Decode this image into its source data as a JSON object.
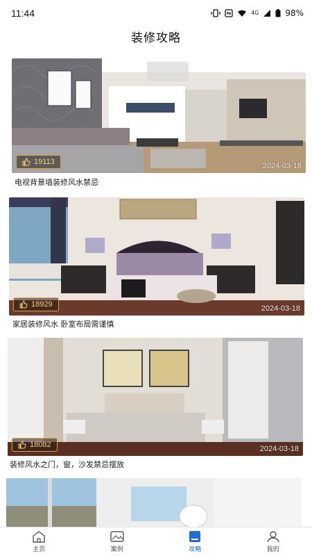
{
  "status_bar": {
    "time": "11:44",
    "signal_label": "4G",
    "battery": "98%"
  },
  "header": {
    "title": "装修攻略"
  },
  "articles": [
    {
      "likes": "19113",
      "date": "2024-03-18",
      "title": "电视背景墙装修风水禁忌"
    },
    {
      "likes": "18929",
      "date": "2024-03-18",
      "title": "家居装修风水 卧室布局需谨慎"
    },
    {
      "likes": "18082",
      "date": "2024-03-18",
      "title": "装修风水之门，窗，沙发禁忌摆放"
    }
  ],
  "tabs": [
    {
      "label": "主页",
      "icon": "home-icon"
    },
    {
      "label": "案例",
      "icon": "gallery-icon"
    },
    {
      "label": "攻略",
      "icon": "book-icon"
    },
    {
      "label": "我的",
      "icon": "user-icon"
    }
  ],
  "colors": {
    "accent": "#1f6fd1",
    "badge_gold": "#d9a441"
  }
}
